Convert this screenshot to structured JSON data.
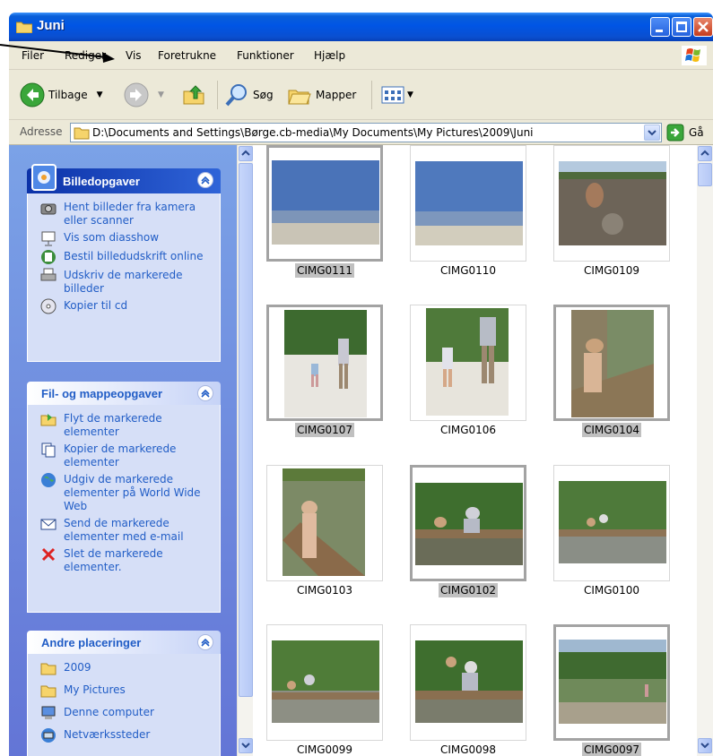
{
  "window": {
    "title": "Juni"
  },
  "menu": [
    "Filer",
    "Rediger",
    "Vis",
    "Foretrukne",
    "Funktioner",
    "Hjælp"
  ],
  "toolbar": {
    "back": "Tilbage",
    "search": "Søg",
    "folders": "Mapper"
  },
  "address": {
    "label": "Adresse",
    "path": "D:\\Documents and Settings\\Børge.cb-media\\My Documents\\My Pictures\\2009\\Juni",
    "go": "Gå"
  },
  "panels": {
    "picture_tasks": {
      "title": "Billedopgaver",
      "items": [
        {
          "label": "Hent billeder fra kamera eller scanner",
          "icon": "camera-icon"
        },
        {
          "label": "Vis som diasshow",
          "icon": "slideshow-icon"
        },
        {
          "label": "Bestil billedudskrift online",
          "icon": "order-prints-icon"
        },
        {
          "label": "Udskriv de markerede billeder",
          "icon": "printer-icon"
        },
        {
          "label": "Kopier til cd",
          "icon": "cd-icon"
        }
      ]
    },
    "file_tasks": {
      "title": "Fil- og mappeopgaver",
      "items": [
        {
          "label": "Flyt de markerede elementer",
          "icon": "move-icon"
        },
        {
          "label": "Kopier de markerede elementer",
          "icon": "copy-icon"
        },
        {
          "label": "Udgiv de markerede elementer på World Wide Web",
          "icon": "web-publish-icon"
        },
        {
          "label": "Send de markerede elementer med e-mail",
          "icon": "email-icon"
        },
        {
          "label": "Slet de markerede elementer.",
          "icon": "delete-icon"
        }
      ]
    },
    "other_places": {
      "title": "Andre placeringer",
      "items": [
        {
          "label": "2009",
          "icon": "folder-icon"
        },
        {
          "label": "My Pictures",
          "icon": "folder-icon"
        },
        {
          "label": "Denne computer",
          "icon": "computer-icon"
        },
        {
          "label": "Netværkssteder",
          "icon": "network-icon"
        }
      ]
    }
  },
  "thumbnails": [
    {
      "name": "CIMG0111",
      "selected": true
    },
    {
      "name": "CIMG0110",
      "selected": false
    },
    {
      "name": "CIMG0109",
      "selected": false
    },
    {
      "name": "CIMG0107",
      "selected": true
    },
    {
      "name": "CIMG0106",
      "selected": false
    },
    {
      "name": "CIMG0104",
      "selected": true
    },
    {
      "name": "CIMG0103",
      "selected": false
    },
    {
      "name": "CIMG0102",
      "selected": true
    },
    {
      "name": "CIMG0100",
      "selected": false
    },
    {
      "name": "CIMG0099",
      "selected": false
    },
    {
      "name": "CIMG0098",
      "selected": false
    },
    {
      "name": "CIMG0097",
      "selected": true
    }
  ],
  "colors": {
    "titlebar": "#0055e5",
    "taskpane": "#6f8ddf",
    "link": "#215dc6",
    "selection": "#c0c0c0"
  }
}
